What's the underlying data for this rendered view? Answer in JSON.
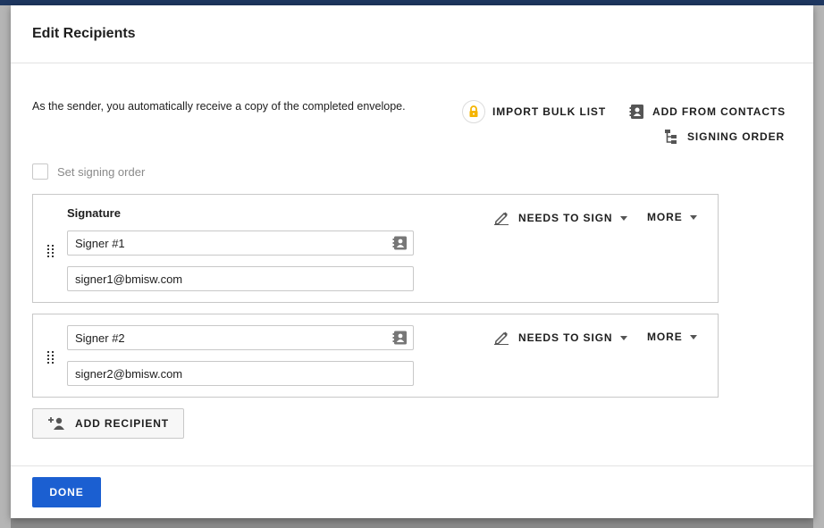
{
  "modal": {
    "title": "Edit Recipients",
    "info_text": "As the sender, you automatically receive a copy of the completed envelope."
  },
  "actions": {
    "import_bulk_list": "IMPORT BULK LIST",
    "add_from_contacts": "ADD FROM CONTACTS",
    "signing_order": "SIGNING ORDER"
  },
  "signing_order_checkbox": {
    "label": "Set signing order",
    "checked": false
  },
  "recipients": [
    {
      "label": "Signature",
      "name": "Signer #1",
      "email": "signer1@bmisw.com",
      "role": "NEEDS TO SIGN",
      "more": "MORE"
    },
    {
      "label": "",
      "name": "Signer #2",
      "email": "signer2@bmisw.com",
      "role": "NEEDS TO SIGN",
      "more": "MORE"
    }
  ],
  "add_recipient_label": "ADD RECIPIENT",
  "done_label": "DONE",
  "colors": {
    "primary": "#1b5fd1",
    "lock_accent": "#f5b400",
    "top_bar": "#1e3760"
  },
  "icons": {
    "import": "lock-icon",
    "contacts": "contact-book-icon",
    "signing_order": "hierarchy-icon",
    "role": "pen-icon",
    "drag": "drag-handle-icon",
    "add_recipient": "add-user-icon"
  }
}
